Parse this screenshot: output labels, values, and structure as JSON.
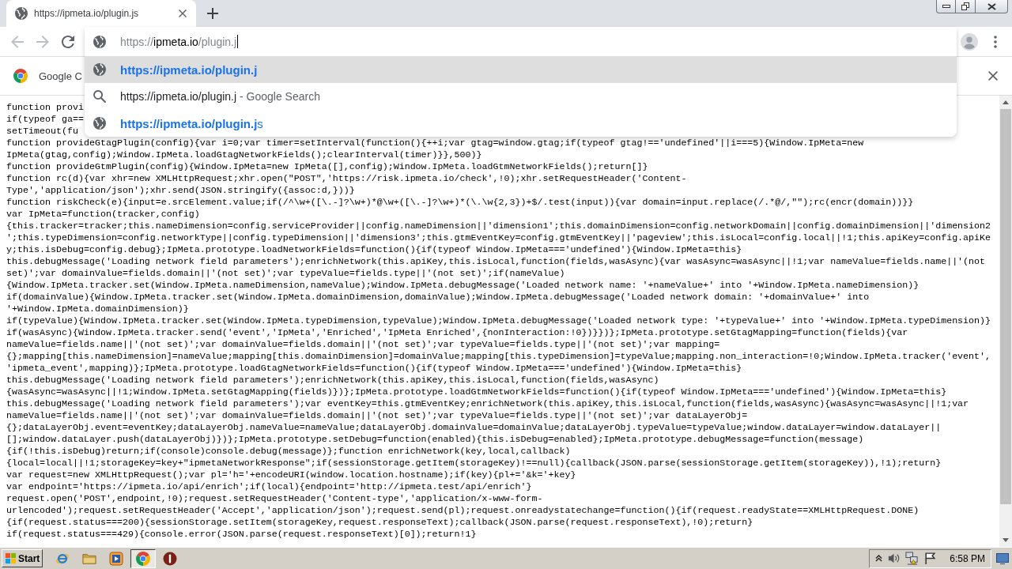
{
  "tabs": [
    {
      "title": "https://ipmeta.io/plugin.js",
      "selected": true
    }
  ],
  "nav_buttons": [
    {
      "kind": "back",
      "disabled": true
    },
    {
      "kind": "forward",
      "disabled": true
    },
    {
      "kind": "reload",
      "disabled": false
    }
  ],
  "omnibox": {
    "value_parts": [
      {
        "text": "https://",
        "emphasized": false
      },
      {
        "text": "ipmeta.io",
        "emphasized": true
      },
      {
        "text": "/plugin.j",
        "emphasized": false
      }
    ],
    "focused": true,
    "suggestions": [
      {
        "kind": "url",
        "selected": true,
        "text": "https://ipmeta.io/plugin.j"
      },
      {
        "kind": "search",
        "selected": false,
        "text": "https://ipmeta.io/plugin.j",
        "suffix": "- Google Search"
      },
      {
        "kind": "url",
        "selected": false,
        "text": "https://ipmeta.io/plugin.j",
        "completion": "s"
      }
    ]
  },
  "infobar": {
    "text": "Google C"
  },
  "code_lines": [
    "function provi",
    "if(typeof ga==",
    "setTimeout(fu",
    "function provideGtagPlugin(config){var i=0;var timer=setInterval(function(){++i;var gtag=window.gtag;if(typeof gtag!=='undefined'||i===5){Window.IpMeta=new",
    "IpMeta(gtag,config);Window.IpMeta.loadGtagNetworkFields();clearInterval(timer)}},500)}",
    "function provideGtmPlugin(config){Window.IpMeta=new IpMeta([],config);Window.IpMeta.loadGtmNetworkFields();return[]}",
    "function rc(d){var xhr=new XMLHttpRequest;xhr.open(\"POST\",'https://risk.ipmeta.io/check',!0);xhr.setRequestHeader('Content-",
    "Type','application/json');xhr.send(JSON.stringify({assoc:d,}))}",
    "function riskCheck(e){input=e.srcElement.value;if(/^\\w+([\\.-]?\\w+)*@\\w+([\\.-]?\\w+)*(\\.\\w{2,3})+$/.test(input)){var domain=input.replace(/.*@/,\"\");rc(encr(domain))}}",
    "var IpMeta=function(tracker,config)",
    "{this.tracker=tracker;this.nameDimension=config.serviceProvider||config.nameDimension||'dimension1';this.domainDimension=config.networkDomain||config.domainDimension||'dimension2",
    "';this.typeDimension=config.networkType||config.typeDimension||'dimension3';this.gtmEventKey=config.gtmEventKey||'pageview';this.isLocal=config.local||!1;this.apiKey=config.apiKe",
    "y;this.isDebug=config.debug};IpMeta.prototype.loadNetworkFields=function(){if(typeof Window.IpMeta==='undefined'){Window.IpMeta=this}",
    "this.debugMessage('Loading network field parameters');enrichNetwork(this.apiKey,this.isLocal,function(fields,wasAsync){var wasAsync=wasAsync||!1;var nameValue=fields.name||'(not",
    "set)';var domainValue=fields.domain||'(not set)';var typeValue=fields.type||'(not set)';if(nameValue)",
    "{Window.IpMeta.tracker.set(Window.IpMeta.nameDimension,nameValue);Window.IpMeta.debugMessage('Loaded network name: '+nameValue+' into '+Window.IpMeta.nameDimension)}",
    "if(domainValue){Window.IpMeta.tracker.set(Window.IpMeta.domainDimension,domainValue);Window.IpMeta.debugMessage('Loaded network domain: '+domainValue+' into",
    "'+Window.IpMeta.domainDimension)}",
    "if(typeValue){Window.IpMeta.tracker.set(Window.IpMeta.typeDimension,typeValue);Window.IpMeta.debugMessage('Loaded network type: '+typeValue+' into '+Window.IpMeta.typeDimension)}",
    "if(wasAsync){Window.IpMeta.tracker.send('event','IpMeta','Enriched','IpMeta Enriched',{nonInteraction:!0})}})};IpMeta.prototype.setGtagMapping=function(fields){var",
    "nameValue=fields.name||'(not set)';var domainValue=fields.domain||'(not set)';var typeValue=fields.type||'(not set)';var mapping=",
    "{};mapping[this.nameDimension]=nameValue;mapping[this.domainDimension]=domainValue;mapping[this.typeDimension]=typeValue;mapping.non_interaction=!0;Window.IpMeta.tracker('event',",
    "'ipmeta_event',mapping)};IpMeta.prototype.loadGtagNetworkFields=function(){if(typeof Window.IpMeta==='undefined'){Window.IpMeta=this}",
    "this.debugMessage('Loading network field parameters');enrichNetwork(this.apiKey,this.isLocal,function(fields,wasAsync)",
    "{wasAsync=wasAsync||!1;Window.IpMeta.setGtagMapping(fields)})};IpMeta.prototype.loadGtmNetworkFields=function(){if(typeof Window.IpMeta==='undefined'){Window.IpMeta=this}",
    "this.debugMessage('Loading network field parameters');var eventKey=this.gtmEventKey;enrichNetwork(this.apiKey,this.isLocal,function(fields,wasAsync){wasAsync=wasAsync||!1;var",
    "nameValue=fields.name||'(not set)';var domainValue=fields.domain||'(not set)';var typeValue=fields.type||'(not set)';var dataLayerObj=",
    "{};dataLayerObj.event=eventKey;dataLayerObj.nameValue=nameValue;dataLayerObj.domainValue=domainValue;dataLayerObj.typeValue=typeValue;window.dataLayer=window.dataLayer||",
    "[];window.dataLayer.push(dataLayerObj)})};IpMeta.prototype.setDebug=function(enabled){this.isDebug=enabled};IpMeta.prototype.debugMessage=function(message)",
    "{if(!this.isDebug)return;if(console)console.debug(message)};function enrichNetwork(key,local,callback)",
    "{local=local||!1;storageKey=key+\"ipmetaNetworkResponse\";if(sessionStorage.getItem(storageKey)!==null){callback(JSON.parse(sessionStorage.getItem(storageKey)),!1);return}",
    "var request=new XMLHttpRequest();var pl='h='+encodeURI(window.location.hostname);if(key){pl+='&k='+key}",
    "var endpoint='https://ipmeta.io/api/enrich';if(local){endpoint='http://ipmeta.test/api/enrich'}",
    "request.open('POST',endpoint,!0);request.setRequestHeader('Content-type','application/x-www-form-",
    "urlencoded');request.setRequestHeader('Accept','application/json');request.send(pl);request.onreadystatechange=function(){if(request.readyState==XMLHttpRequest.DONE)",
    "{if(request.status===200){sessionStorage.setItem(storageKey,request.responseText);callback(JSON.parse(request.responseText),!0);return}",
    "if(request.status===429){console.error(JSON.parse(request.responseText)[0]);return!1}"
  ],
  "taskbar": {
    "start_label": "Start",
    "apps": [
      {
        "kind": "e-logo",
        "selected": false
      },
      {
        "kind": "folder",
        "selected": false
      },
      {
        "kind": "player",
        "selected": false
      },
      {
        "kind": "circle-logo",
        "selected": true
      },
      {
        "kind": "circle-bar",
        "selected": false
      }
    ],
    "clock": "6:58 PM"
  }
}
